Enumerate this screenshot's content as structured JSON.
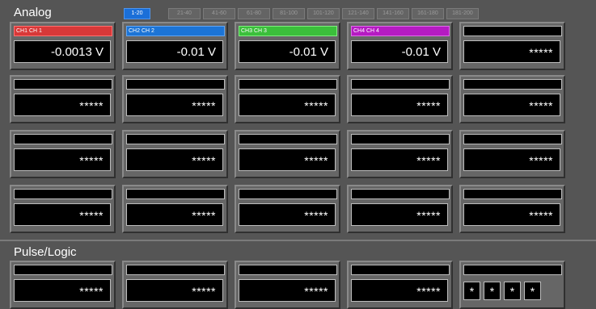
{
  "analog": {
    "title": "Analog",
    "tabs": [
      {
        "label": "1-20",
        "active": true
      },
      {
        "label": "21-40",
        "active": false
      },
      {
        "label": "41-60",
        "active": false
      },
      {
        "label": "61-80",
        "active": false
      },
      {
        "label": "81-100",
        "active": false
      },
      {
        "label": "101-120",
        "active": false
      },
      {
        "label": "121-140",
        "active": false
      },
      {
        "label": "141-160",
        "active": false
      },
      {
        "label": "161-180",
        "active": false
      },
      {
        "label": "181-200",
        "active": false
      }
    ],
    "channels": [
      {
        "label": "CH1  CH 1",
        "value": "-0.0013 V",
        "color": "#d83838"
      },
      {
        "label": "CH2  CH 2",
        "value": "-0.01 V",
        "color": "#1c74d6"
      },
      {
        "label": "CH3  CH 3",
        "value": "-0.01 V",
        "color": "#3bbf3b"
      },
      {
        "label": "CH4  CH 4",
        "value": "-0.01 V",
        "color": "#b51bc2"
      },
      {
        "label": "",
        "value": "*****"
      },
      {
        "label": "",
        "value": "*****"
      },
      {
        "label": "",
        "value": "*****"
      },
      {
        "label": "",
        "value": "*****"
      },
      {
        "label": "",
        "value": "*****"
      },
      {
        "label": "",
        "value": "*****"
      },
      {
        "label": "",
        "value": "*****"
      },
      {
        "label": "",
        "value": "*****"
      },
      {
        "label": "",
        "value": "*****"
      },
      {
        "label": "",
        "value": "*****"
      },
      {
        "label": "",
        "value": "*****"
      },
      {
        "label": "",
        "value": "*****"
      },
      {
        "label": "",
        "value": "*****"
      },
      {
        "label": "",
        "value": "*****"
      },
      {
        "label": "",
        "value": "*****"
      },
      {
        "label": "",
        "value": "*****"
      }
    ]
  },
  "pulse": {
    "title": "Pulse/Logic",
    "channels": [
      {
        "label": "",
        "value": "*****"
      },
      {
        "label": "",
        "value": "*****"
      },
      {
        "label": "",
        "value": "*****"
      },
      {
        "label": "",
        "value": "*****"
      }
    ],
    "logic": {
      "label": "",
      "bits": [
        "*",
        "*",
        "*",
        "*"
      ]
    }
  }
}
